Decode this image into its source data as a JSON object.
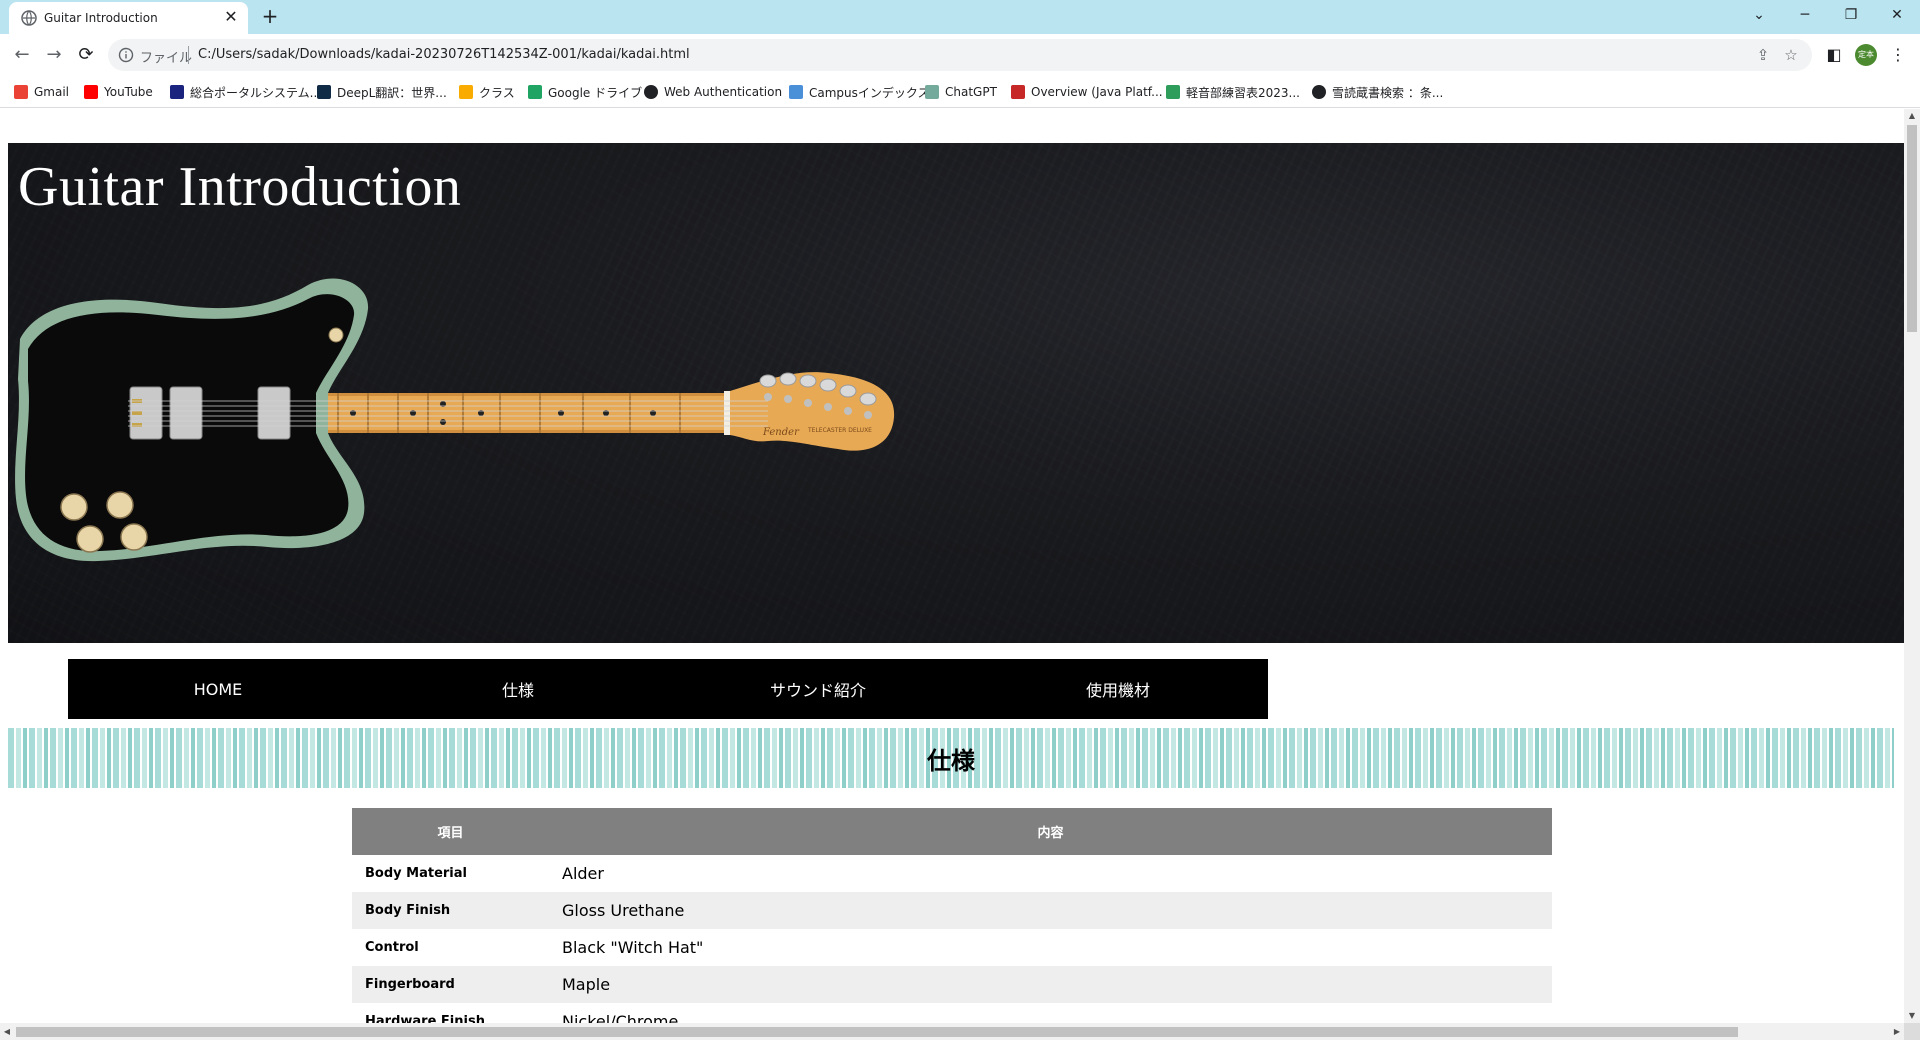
{
  "browser": {
    "tab_title": "Guitar Introduction",
    "tab_close": "✕",
    "new_tab": "+",
    "window_controls": [
      "⌄",
      "─",
      "❐",
      "✕"
    ],
    "nav": {
      "back": "←",
      "forward": "→",
      "reload": "⟳"
    },
    "address": {
      "scheme_label": "ファイル",
      "url": "C:/Users/sadak/Downloads/kadai-20230726T142534Z-001/kadai/kadai.html",
      "share_icon": "⇪",
      "star_icon": "☆"
    },
    "sidepanel_icon": "◧",
    "avatar_text": "定本",
    "menu_icon": "⋮"
  },
  "bookmarks": [
    {
      "label": "Gmail",
      "color": "#ea4335"
    },
    {
      "label": "YouTube",
      "color": "#ff0000"
    },
    {
      "label": "総合ポータルシステム...",
      "color": "#1a237e"
    },
    {
      "label": "DeepL翻訳：世界...",
      "color": "#0f2b46"
    },
    {
      "label": "クラス",
      "color": "#f9ab00"
    },
    {
      "label": "Google ドライブ",
      "color": "#1fa463"
    },
    {
      "label": "Web Authentication",
      "color": "#202124"
    },
    {
      "label": "Campusインデックス",
      "color": "#4a90d9"
    },
    {
      "label": "ChatGPT",
      "color": "#74aa9c"
    },
    {
      "label": "Overview (Java Platf...",
      "color": "#c62828"
    },
    {
      "label": "軽音部練習表2023...",
      "color": "#2e9d5b"
    },
    {
      "label": "雪読蔵書検索 ：条...",
      "color": "#202124"
    }
  ],
  "page": {
    "title": "Guitar Introduction",
    "nav": [
      "HOME",
      "仕様",
      "サウンド紹介",
      "使用機材"
    ],
    "section_heading": "仕様",
    "table": {
      "headers": [
        "項目",
        "内容"
      ],
      "rows": [
        {
          "key": "Body Material",
          "value": "Alder"
        },
        {
          "key": "Body Finish",
          "value": "Gloss Urethane"
        },
        {
          "key": "Control",
          "value": "Black \"Witch Hat\""
        },
        {
          "key": "Fingerboard",
          "value": "Maple"
        },
        {
          "key": "Hardware Finish",
          "value": "Nickel/Chrome"
        }
      ]
    },
    "guitar": {
      "headstock_logo": "Fender",
      "headstock_model": "TELECASTER DELUXE",
      "body_color": "#8fb39b",
      "pickguard_color": "#0a0a0a",
      "neck_color": "#e6a452"
    }
  }
}
